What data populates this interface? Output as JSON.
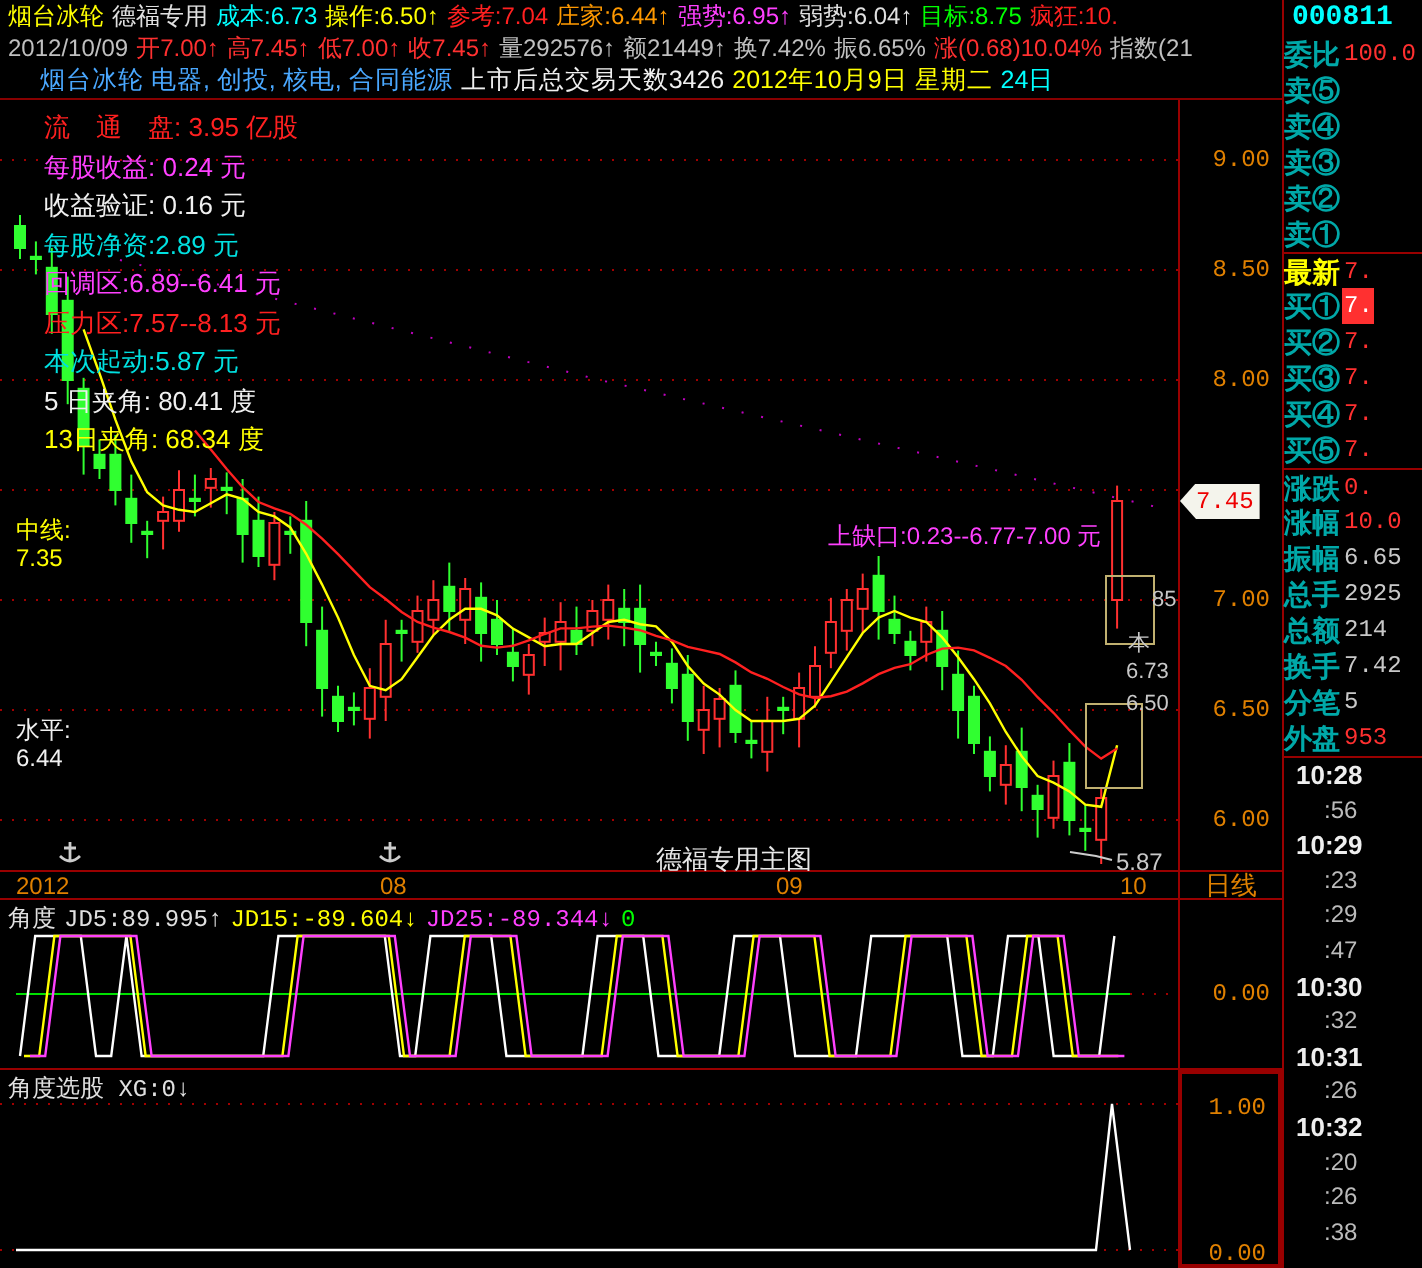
{
  "header": {
    "line1": [
      {
        "text": "烟台冰轮",
        "color": "#ffff00"
      },
      {
        "text": "德福专用",
        "color": "#e0e0e0"
      },
      {
        "text": "成本:6.73",
        "color": "#00ffff"
      },
      {
        "text": "操作:6.50↑",
        "color": "#ffff00"
      },
      {
        "text": "参考:7.04",
        "color": "#ff2020"
      },
      {
        "text": "庄家:6.44↑",
        "color": "#ff9900"
      },
      {
        "text": "强势:6.95↑",
        "color": "#ff40ff"
      },
      {
        "text": "弱势:6.04↑",
        "color": "#e0e0e0"
      },
      {
        "text": "目标:8.75",
        "color": "#00ff00"
      },
      {
        "text": "疯狂:10.",
        "color": "#ff2020"
      }
    ],
    "line2": [
      {
        "text": "2012/10/09",
        "color": "#c0c0c0"
      },
      {
        "text": "开7.00↑",
        "color": "#ff3030"
      },
      {
        "text": "高7.45↑",
        "color": "#ff3030"
      },
      {
        "text": "低7.00↑",
        "color": "#ff3030"
      },
      {
        "text": "收7.45↑",
        "color": "#ff3030"
      },
      {
        "text": "量292576↑",
        "color": "#c0c0c0"
      },
      {
        "text": "额21449↑",
        "color": "#c0c0c0"
      },
      {
        "text": "换7.42%",
        "color": "#c0c0c0"
      },
      {
        "text": "振6.65%",
        "color": "#c0c0c0"
      },
      {
        "text": "涨(0.68)10.04%",
        "color": "#ff3030"
      },
      {
        "text": "指数(21",
        "color": "#c0c0c0"
      }
    ],
    "line3": [
      {
        "text": "烟台冰轮  电器, 创投, 核电, 合同能源",
        "color": "#4aa8ff"
      },
      {
        "text": "上市后总交易天数3426",
        "color": "#f0f0f0"
      },
      {
        "text": "2012年10月9日 星期二",
        "color": "#ffff00"
      },
      {
        "text": "24日",
        "color": "#00ffff"
      }
    ]
  },
  "main_chart": {
    "info": [
      {
        "text": "流　通　盘: 3.95 亿股",
        "color": "#ff2020"
      },
      {
        "text": "每股收益:  0.24  元",
        "color": "#ff40ff"
      },
      {
        "text": "收益验证:  0.16  元",
        "color": "#f0f0f0"
      },
      {
        "text": "每股净资:2.89 元",
        "color": "#00e0e0"
      },
      {
        "text": "回调区:6.89--6.41 元",
        "color": "#ff40ff"
      },
      {
        "text": "压力区:7.57--8.13 元",
        "color": "#ff2020"
      },
      {
        "text": "本次起动:5.87 元",
        "color": "#00e0e0"
      },
      {
        "text": "5 日夹角: 80.41 度",
        "color": "#f0f0f0"
      },
      {
        "text": "13日夹角: 68.34 度",
        "color": "#ffff00"
      }
    ],
    "midline": {
      "label": "中线:",
      "value": "7.35"
    },
    "level": {
      "label": "水平:",
      "value": "6.44"
    },
    "gap_label": "上缺口:0.23--6.77-7.00 元",
    "box_labels": [
      "85",
      "本",
      "6.73",
      "6.50"
    ],
    "low_label": "5.87",
    "title": "德福专用主图",
    "yticks": [
      "9.00",
      "8.50",
      "8.00",
      "7.00",
      "6.50",
      "6.00"
    ],
    "price_tag": "7.45",
    "xticks": [
      "2012",
      "08",
      "09",
      "10"
    ],
    "period": "日线"
  },
  "indicator_1": {
    "header": [
      {
        "text": "角度",
        "color": "#e0e0e0"
      },
      {
        "text": "JD5:89.995↑",
        "color": "#e0e0e0"
      },
      {
        "text": "JD15:-89.604↓",
        "color": "#ffff00"
      },
      {
        "text": "JD25:-89.344↓",
        "color": "#ff40ff"
      },
      {
        "text": "0",
        "color": "#00ff00"
      }
    ],
    "ytick": "0.00"
  },
  "indicator_2": {
    "header": "角度选股 XG:0↓",
    "yticks": [
      "1.00",
      "0.00"
    ]
  },
  "quote_panel": {
    "code": "000811",
    "rows": [
      {
        "label": "委比",
        "value": "100.0",
        "kind": "stat",
        "color": "#ff3030",
        "highlighted": false
      },
      {
        "label": "卖⑤",
        "kind": "sell",
        "highlighted": false
      },
      {
        "label": "卖④",
        "kind": "sell",
        "highlighted": false
      },
      {
        "label": "卖③",
        "kind": "sell",
        "highlighted": false
      },
      {
        "label": "卖②",
        "kind": "sell",
        "highlighted": false
      },
      {
        "label": "卖①",
        "kind": "sell",
        "highlighted": false
      },
      {
        "label": "最新",
        "value": "7.",
        "kind": "latest",
        "color": "#ff3030",
        "highlighted": false
      },
      {
        "label": "买①",
        "value": "7.",
        "kind": "buy",
        "color": "#ff3030",
        "highlighted": true
      },
      {
        "label": "买②",
        "value": "7.",
        "kind": "buy",
        "color": "#ff3030",
        "highlighted": false
      },
      {
        "label": "买③",
        "value": "7.",
        "kind": "buy",
        "color": "#ff3030",
        "highlighted": false
      },
      {
        "label": "买④",
        "value": "7.",
        "kind": "buy",
        "color": "#ff3030",
        "highlighted": false
      },
      {
        "label": "买⑤",
        "value": "7.",
        "kind": "buy",
        "color": "#ff3030",
        "highlighted": false
      },
      {
        "label": "涨跌",
        "value": "0.",
        "kind": "stat",
        "color": "#ff3030",
        "highlighted": false
      },
      {
        "label": "涨幅",
        "value": "10.0",
        "kind": "stat",
        "color": "#ff3030",
        "highlighted": false
      },
      {
        "label": "振幅",
        "value": "6.65",
        "kind": "stat",
        "color": "#c8c8c8",
        "highlighted": false
      },
      {
        "label": "总手",
        "value": "2925",
        "kind": "stat",
        "color": "#c8c8c8",
        "highlighted": false
      },
      {
        "label": "总额",
        "value": "214",
        "kind": "stat",
        "color": "#c8c8c8",
        "highlighted": false
      },
      {
        "label": "换手",
        "value": "7.42",
        "kind": "stat",
        "color": "#c8c8c8",
        "highlighted": false
      },
      {
        "label": "分笔",
        "value": "5",
        "kind": "stat",
        "color": "#c8c8c8",
        "highlighted": false
      },
      {
        "label": "外盘",
        "value": "953",
        "kind": "stat",
        "color": "#ff3030",
        "highlighted": false
      }
    ],
    "times": [
      {
        "text": "10:28",
        "kind": "minute"
      },
      {
        "text": ":56",
        "kind": "second"
      },
      {
        "text": "10:29",
        "kind": "minute"
      },
      {
        "text": ":23",
        "kind": "second"
      },
      {
        "text": ":29",
        "kind": "second"
      },
      {
        "text": ":47",
        "kind": "second"
      },
      {
        "text": "10:30",
        "kind": "minute"
      },
      {
        "text": ":32",
        "kind": "second"
      },
      {
        "text": "10:31",
        "kind": "minute"
      },
      {
        "text": ":26",
        "kind": "second"
      },
      {
        "text": "10:32",
        "kind": "minute"
      },
      {
        "text": ":20",
        "kind": "second"
      },
      {
        "text": ":26",
        "kind": "second"
      },
      {
        "text": ":38",
        "kind": "second"
      }
    ]
  }
}
